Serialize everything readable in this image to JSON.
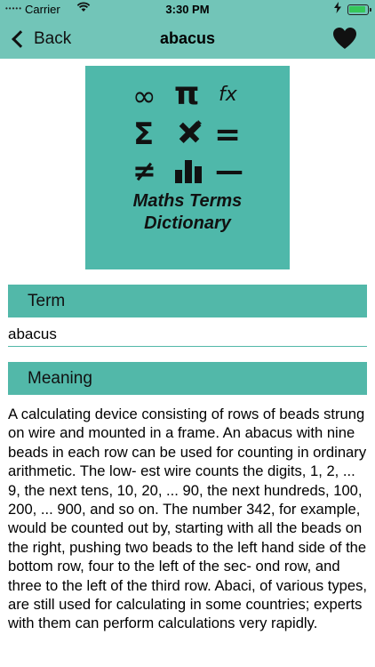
{
  "status_bar": {
    "signal": "•••••",
    "carrier": "Carrier",
    "wifi_icon": "wifi-icon",
    "time": "3:30 PM",
    "battery_icon": "battery-charging-icon"
  },
  "nav": {
    "back_label": "Back",
    "title": "abacus",
    "favorite_icon": "heart-icon"
  },
  "logo": {
    "symbols": {
      "infinity": "∞",
      "pi": "π",
      "function": "fx",
      "sigma": "Σ",
      "equals": "=",
      "not_equal": "≠",
      "minus": "—"
    },
    "line1": "Maths Terms",
    "line2": "Dictionary"
  },
  "term_section": {
    "header": "Term",
    "value": "abacus"
  },
  "meaning_section": {
    "header": "Meaning",
    "text": "A calculating device consisting of rows of beads strung on wire and mounted in a frame. An abacus with nine beads in each row can be used for counting in ordinary arithmetic. The low- est wire counts the digits, 1, 2, ... 9, the next tens, 10, 20, ... 90, the next hundreds, 100, 200, ... 900, and so on. The number 342, for example, would be counted out by, starting with all the beads on the right, pushing two beads to the left hand side of the bottom row, four to the left of the sec- ond row, and three to the left of the third row. Abaci, of various types, are still used for calculating in some countries; experts with them can perform calculations very rapidly."
  },
  "colors": {
    "navbar": "#72c5b8",
    "accent": "#52b8a9",
    "logo_bg": "#4fb8aa"
  }
}
